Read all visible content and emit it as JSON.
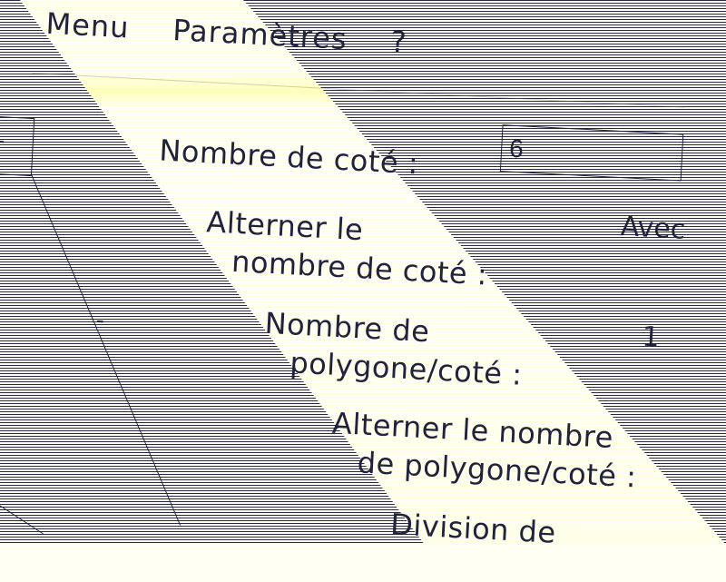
{
  "menubar": {
    "menu_label": "Menu",
    "params_label": "Paramètres",
    "help_label": "?"
  },
  "settings": {
    "side_count_label": "Nombre de coté :",
    "side_count_value": "6",
    "alternate_side_label_line1": "Alterner le",
    "alternate_side_label_line2": "nombre de coté :",
    "alternate_side_value": "Avec",
    "polygon_count_label_line1": "Nombre de",
    "polygon_count_label_line2": "polygone/coté :",
    "polygon_count_value": "1",
    "alternate_polygon_label_line1": "Alterner le nombre",
    "alternate_polygon_label_line2": "de polygone/coté :",
    "division_label": "Division de"
  },
  "sidebar": {
    "dash_1": "-",
    "dash_2": "-"
  },
  "colors": {
    "ink": "#22223a",
    "glare": "#fffff4"
  }
}
